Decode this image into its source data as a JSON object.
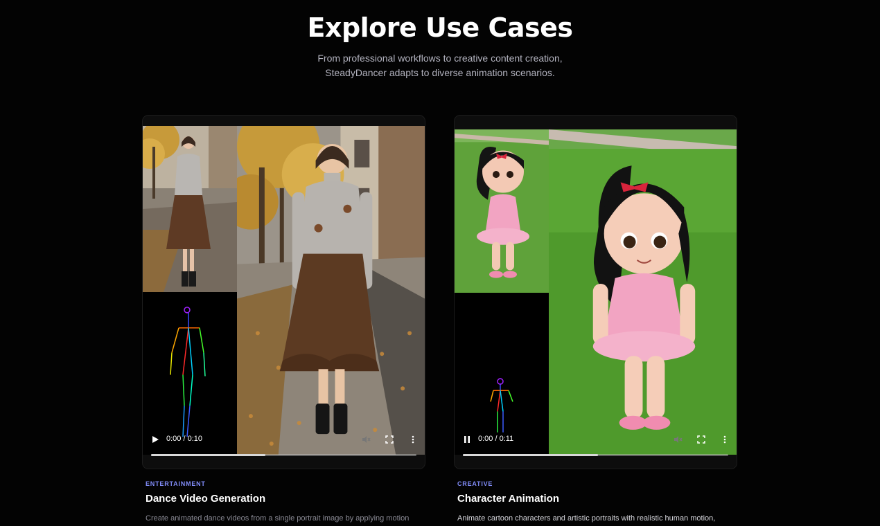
{
  "hero": {
    "title": "Explore Use Cases",
    "subtitle_line1": "From professional workflows to creative content creation,",
    "subtitle_line2": "SteadyDancer adapts to diverse animation scenarios."
  },
  "cards": [
    {
      "category": "ENTERTAINMENT",
      "title": "Dance Video Generation",
      "description": "Create animated dance videos from a single portrait image by applying motion",
      "video": {
        "time": "0:00 / 0:10",
        "state": "paused",
        "progress": 0.43,
        "play_icon": "play-icon"
      }
    },
    {
      "category": "CREATIVE",
      "title": "Character Animation",
      "description": "Animate cartoon characters and artistic portraits with realistic human motion,",
      "video": {
        "time": "0:00 / 0:11",
        "state": "playing",
        "progress": 0.51,
        "play_icon": "pause-icon"
      }
    }
  ],
  "colors": {
    "accent": "#818cf8",
    "background": "#030303"
  }
}
